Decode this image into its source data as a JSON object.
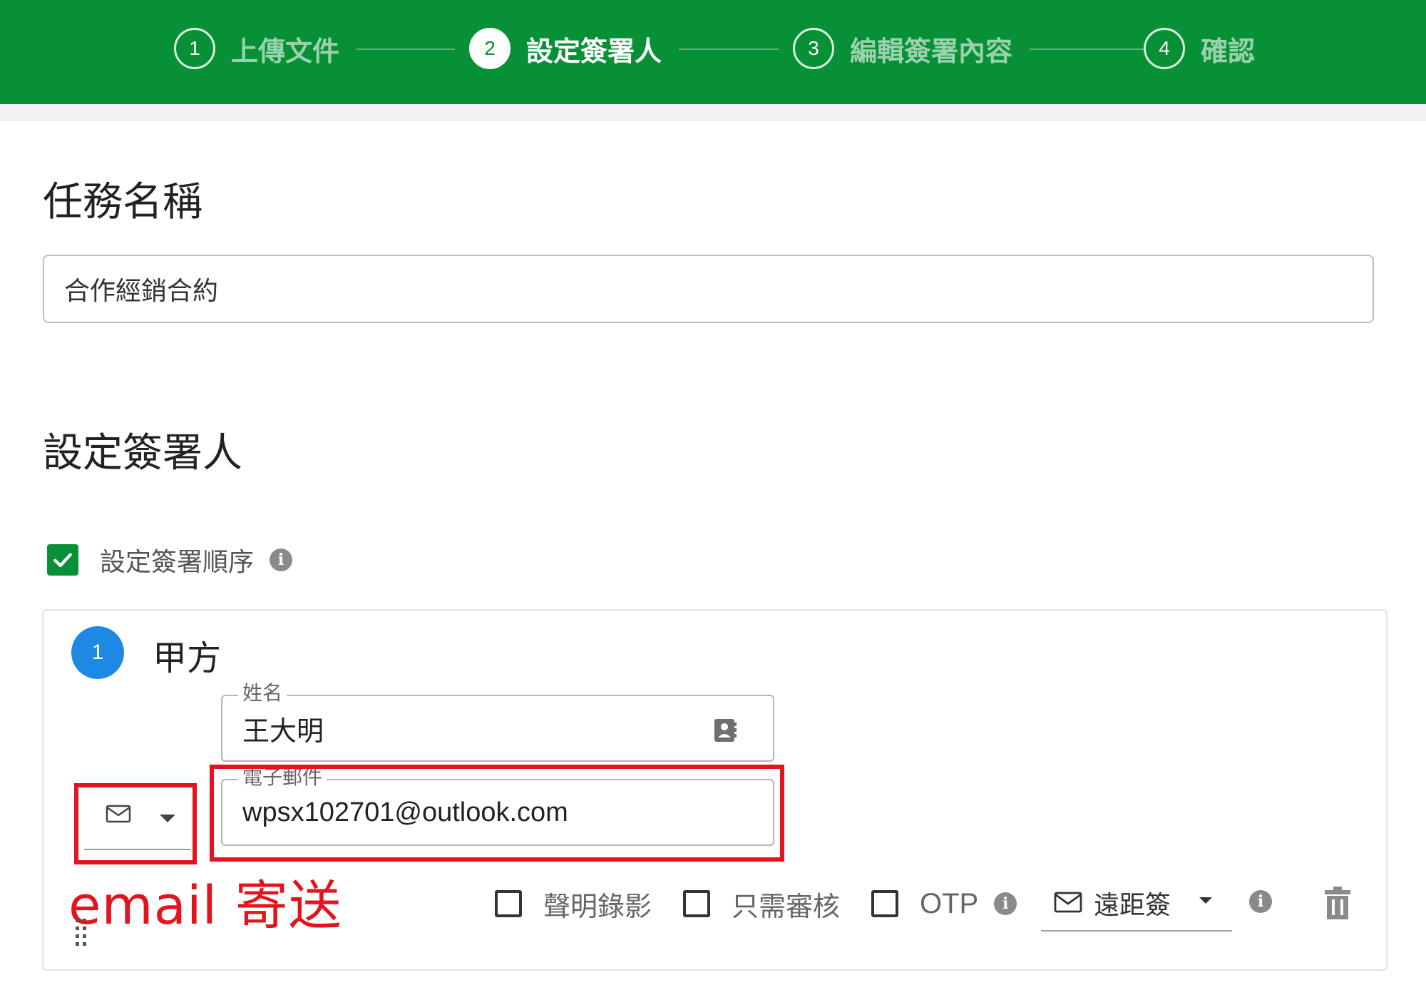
{
  "stepper": {
    "steps": [
      {
        "number": "1",
        "label": "上傳文件"
      },
      {
        "number": "2",
        "label": "設定簽署人"
      },
      {
        "number": "3",
        "label": "編輯簽署內容"
      },
      {
        "number": "4",
        "label": "確認"
      }
    ],
    "active_step": 2
  },
  "task": {
    "title": "任務名稱",
    "value": "合作經銷合約"
  },
  "signers_section": {
    "title": "設定簽署人",
    "order_checkbox_label": "設定簽署順序",
    "order_checked": true
  },
  "signer": {
    "index": "1",
    "party": "甲方",
    "name_label": "姓名",
    "name_value": "王大明",
    "email_label": "電子郵件",
    "email_value": "wpsx102701@outlook.com",
    "delivery_method_icon": "mail-icon"
  },
  "options": {
    "video_label": "聲明錄影",
    "review_only_label": "只需審核",
    "otp_label": "OTP",
    "signing_mode_label": "遠距簽"
  },
  "annotation": {
    "note": "email 寄送"
  },
  "colors": {
    "header_green": "#079035",
    "badge_blue": "#1e88e5",
    "annotation_red": "#e3141e"
  }
}
